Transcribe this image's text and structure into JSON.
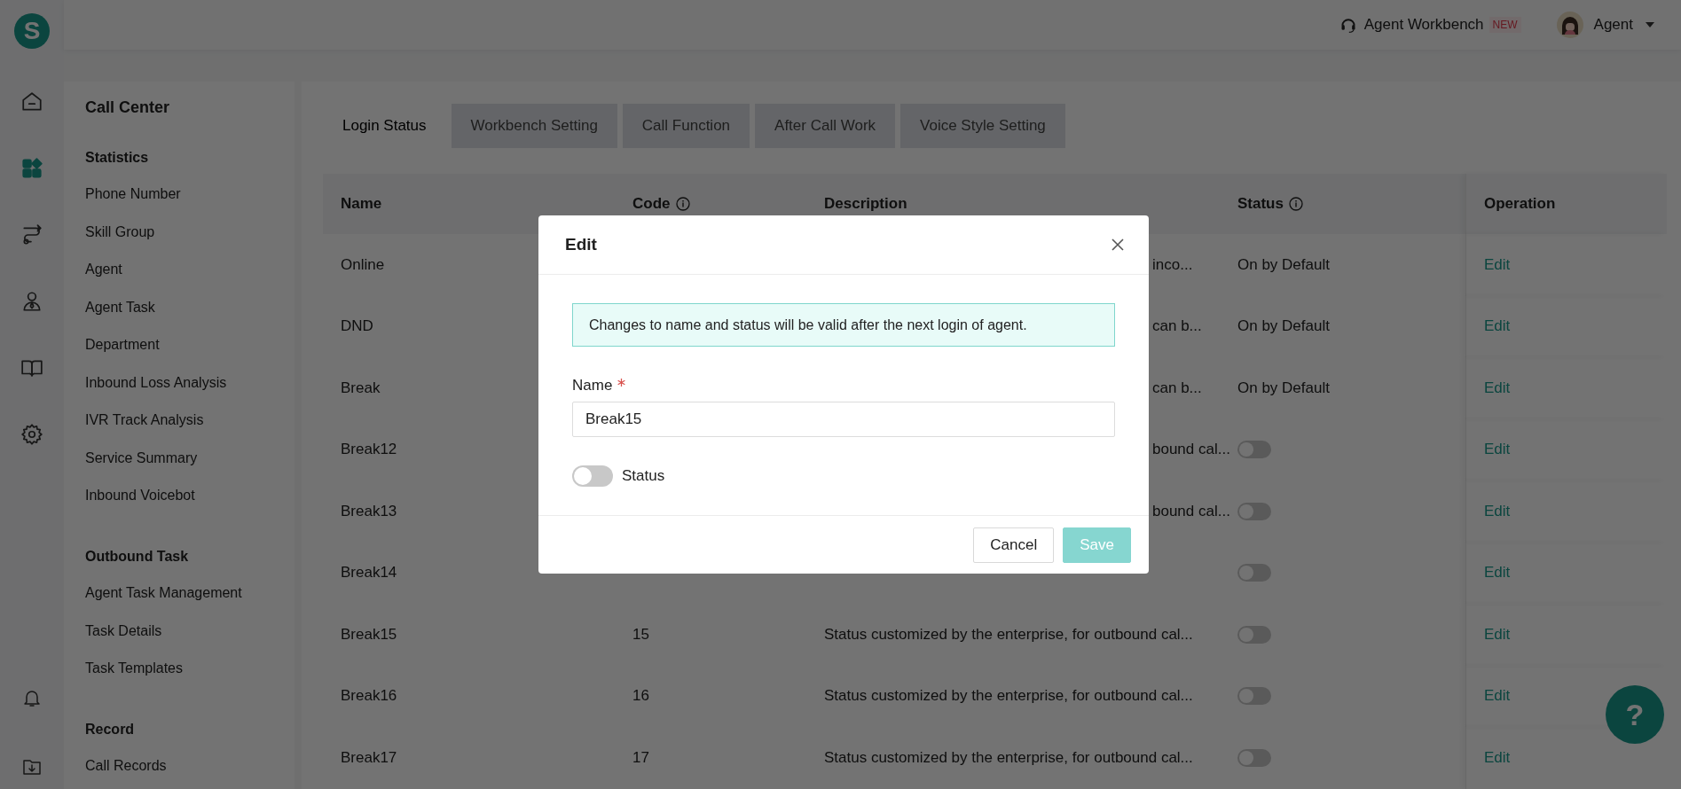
{
  "logo_letter": "S",
  "rail": [
    {
      "kind": "home",
      "selected": false
    },
    {
      "kind": "apps",
      "selected": true
    },
    {
      "kind": "route",
      "selected": false
    },
    {
      "kind": "person",
      "selected": false
    },
    {
      "kind": "book",
      "selected": false
    },
    {
      "kind": "gear",
      "selected": false
    }
  ],
  "rail_bottom": [
    {
      "kind": "bell"
    },
    {
      "kind": "download"
    }
  ],
  "header": {
    "workbench": "Agent Workbench",
    "badge": "NEW",
    "user": "Agent"
  },
  "sidebar": {
    "title": "Call Center",
    "sections": [
      {
        "heading": "Statistics",
        "items": [
          "Phone Number",
          "Skill Group",
          "Agent",
          "Agent Task",
          "Department",
          "Inbound Loss Analysis",
          "IVR Track Analysis",
          "Service Summary",
          "Inbound Voicebot"
        ]
      },
      {
        "heading": "Outbound Task",
        "items": [
          "Agent Task Management",
          "Task Details",
          "Task Templates"
        ]
      },
      {
        "heading": "Record",
        "items": [
          "Call Records"
        ]
      }
    ]
  },
  "tabs": [
    {
      "label": "Login Status",
      "selected": true
    },
    {
      "label": "Workbench Setting",
      "selected": false
    },
    {
      "label": "Call Function",
      "selected": false
    },
    {
      "label": "After Call Work",
      "selected": false
    },
    {
      "label": "Voice Style Setting",
      "selected": false
    }
  ],
  "table": {
    "columns": [
      {
        "label": "Name",
        "info": false
      },
      {
        "label": "Code",
        "info": true
      },
      {
        "label": "Description",
        "info": false
      },
      {
        "label": "Status",
        "info": true
      },
      {
        "label": "Operation",
        "info": false
      }
    ],
    "rows": [
      {
        "name": "Online",
        "description_tail": "inco...",
        "kind": "default",
        "status": "On by Default",
        "operation": "Edit"
      },
      {
        "name": "DND",
        "description_tail": "can b...",
        "kind": "default",
        "status": "On by Default",
        "operation": "Edit"
      },
      {
        "name": "Break",
        "description_tail": "can b...",
        "kind": "default",
        "status": "On by Default",
        "operation": "Edit"
      },
      {
        "name": "Break12",
        "description_tail": "bound cal...",
        "kind": "custom",
        "on": false,
        "operation": "Edit"
      },
      {
        "name": "Break13",
        "description_tail": "bound cal...",
        "kind": "custom",
        "on": false,
        "operation": "Edit"
      },
      {
        "name": "Break14",
        "kind": "custom",
        "on": false,
        "operation": "Edit"
      },
      {
        "name": "Break15",
        "code": "15",
        "description": "Status customized by the enterprise, for outbound cal...",
        "kind": "custom",
        "on": false,
        "operation": "Edit"
      },
      {
        "name": "Break16",
        "code": "16",
        "description": "Status customized by the enterprise, for outbound cal...",
        "kind": "custom",
        "on": false,
        "operation": "Edit"
      },
      {
        "name": "Break17",
        "code": "17",
        "description": "Status customized by the enterprise, for outbound cal...",
        "kind": "custom",
        "on": false,
        "operation": "Edit"
      }
    ]
  },
  "help_glyph": "?",
  "dialog": {
    "title": "Edit",
    "notice": "Changes to name and status will be valid after the next login of agent.",
    "name_label": "Name",
    "required": true,
    "name_value": "Break15",
    "status_label": "Status",
    "status_on": false,
    "buttons": [
      {
        "label": "Cancel",
        "kind": "default",
        "disabled": false
      },
      {
        "label": "Save",
        "kind": "primary",
        "disabled": true
      }
    ]
  }
}
